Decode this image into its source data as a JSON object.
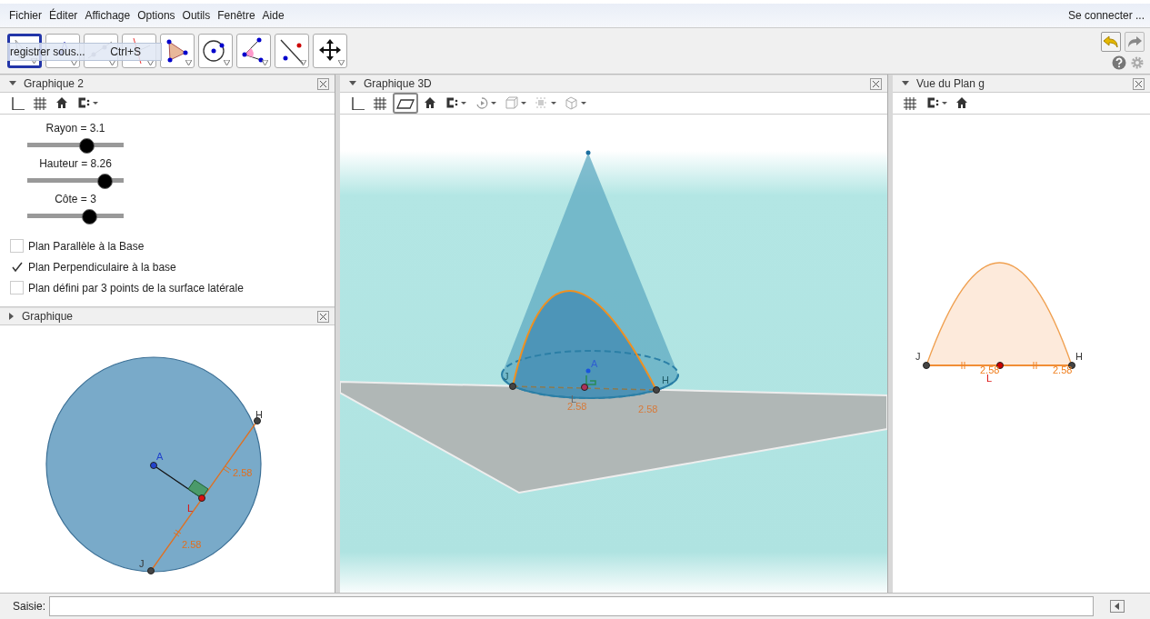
{
  "menu": [
    "Fichier",
    "Éditer",
    "Affichage",
    "Options",
    "Outils",
    "Fenêtre",
    "Aide"
  ],
  "login": "Se connecter ...",
  "tools": [
    {
      "kind": "move",
      "selected": true
    },
    {
      "kind": "point",
      "selected": false
    },
    {
      "kind": "line",
      "selected": false
    },
    {
      "kind": "perpendicular",
      "selected": false
    },
    {
      "kind": "polygon",
      "selected": false
    },
    {
      "kind": "circle",
      "selected": false
    },
    {
      "kind": "angle",
      "selected": false
    },
    {
      "kind": "reflect",
      "selected": false
    },
    {
      "kind": "pan",
      "selected": false
    }
  ],
  "tooltip": {
    "text": "registrer sous...",
    "shortcut": "Ctrl+S"
  },
  "graphique2": {
    "title": "Graphique 2",
    "expanded": true,
    "icons": [
      {
        "kind": "axes",
        "selected": false
      },
      {
        "kind": "grid",
        "selected": false
      },
      {
        "kind": "home",
        "selected": false
      },
      {
        "kind": "style",
        "selected": false
      }
    ],
    "sliders": [
      {
        "label": "Rayon = 3.1",
        "level": 0.61
      },
      {
        "label": "Hauteur = 8.26",
        "level": 0.8
      },
      {
        "label": "Côte = 3",
        "level": 0.64
      }
    ],
    "checkboxes": [
      {
        "label": "Plan Parallèle à la Base",
        "checked": false
      },
      {
        "label": "Plan Perpendiculaire à la base",
        "checked": true
      },
      {
        "label": "Plan défini par 3 points de la surface latérale",
        "checked": false
      }
    ]
  },
  "graphique": {
    "title": "Graphique",
    "expanded": false,
    "points": {
      "A": "A",
      "H": "H",
      "J": "J",
      "L": "L"
    },
    "measures": [
      "2.58",
      "2.58"
    ]
  },
  "graphique3d": {
    "title": "Graphique 3D",
    "expanded": true,
    "icons": [
      {
        "kind": "axes",
        "selected": false
      },
      {
        "kind": "grid",
        "selected": false
      },
      {
        "kind": "plane",
        "selected": true
      },
      {
        "kind": "home",
        "selected": false
      },
      {
        "kind": "style",
        "selected": false
      },
      {
        "kind": "rotate",
        "selected": false
      },
      {
        "kind": "cube",
        "selected": false
      },
      {
        "kind": "points",
        "selected": false
      },
      {
        "kind": "view",
        "selected": false
      }
    ],
    "points": {
      "A": "A",
      "H": "H",
      "J": "J",
      "L": "L"
    },
    "measures": [
      "2.58",
      "2.58"
    ]
  },
  "plan": {
    "title": "Vue du Plan g",
    "expanded": true,
    "icons": [
      {
        "kind": "grid",
        "selected": false
      },
      {
        "kind": "style",
        "selected": false
      },
      {
        "kind": "home",
        "selected": false
      }
    ],
    "points": {
      "H": "H",
      "J": "J",
      "L": "L"
    },
    "measures": [
      "2.58",
      "2.58"
    ]
  },
  "input": {
    "label": "Saisie:"
  }
}
